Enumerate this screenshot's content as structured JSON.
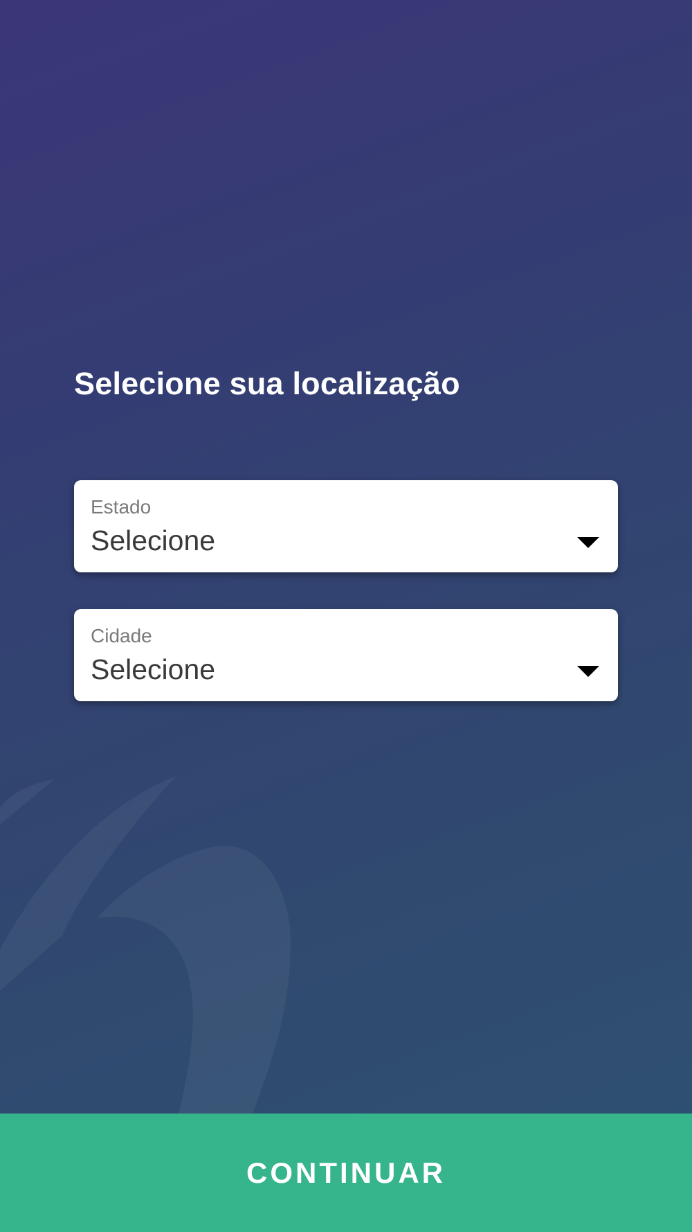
{
  "page": {
    "title": "Selecione sua localização"
  },
  "fields": {
    "estado": {
      "label": "Estado",
      "value": "Selecione"
    },
    "cidade": {
      "label": "Cidade",
      "value": "Selecione"
    }
  },
  "actions": {
    "continue_label": "CONTINUAR"
  },
  "icons": {
    "dropdown": "caret-down-icon",
    "watermark": "brand-watermark"
  },
  "colors": {
    "background_top": "#3b3677",
    "background_bottom": "#2e5271",
    "button": "#36b48b",
    "field_background": "#ffffff"
  }
}
